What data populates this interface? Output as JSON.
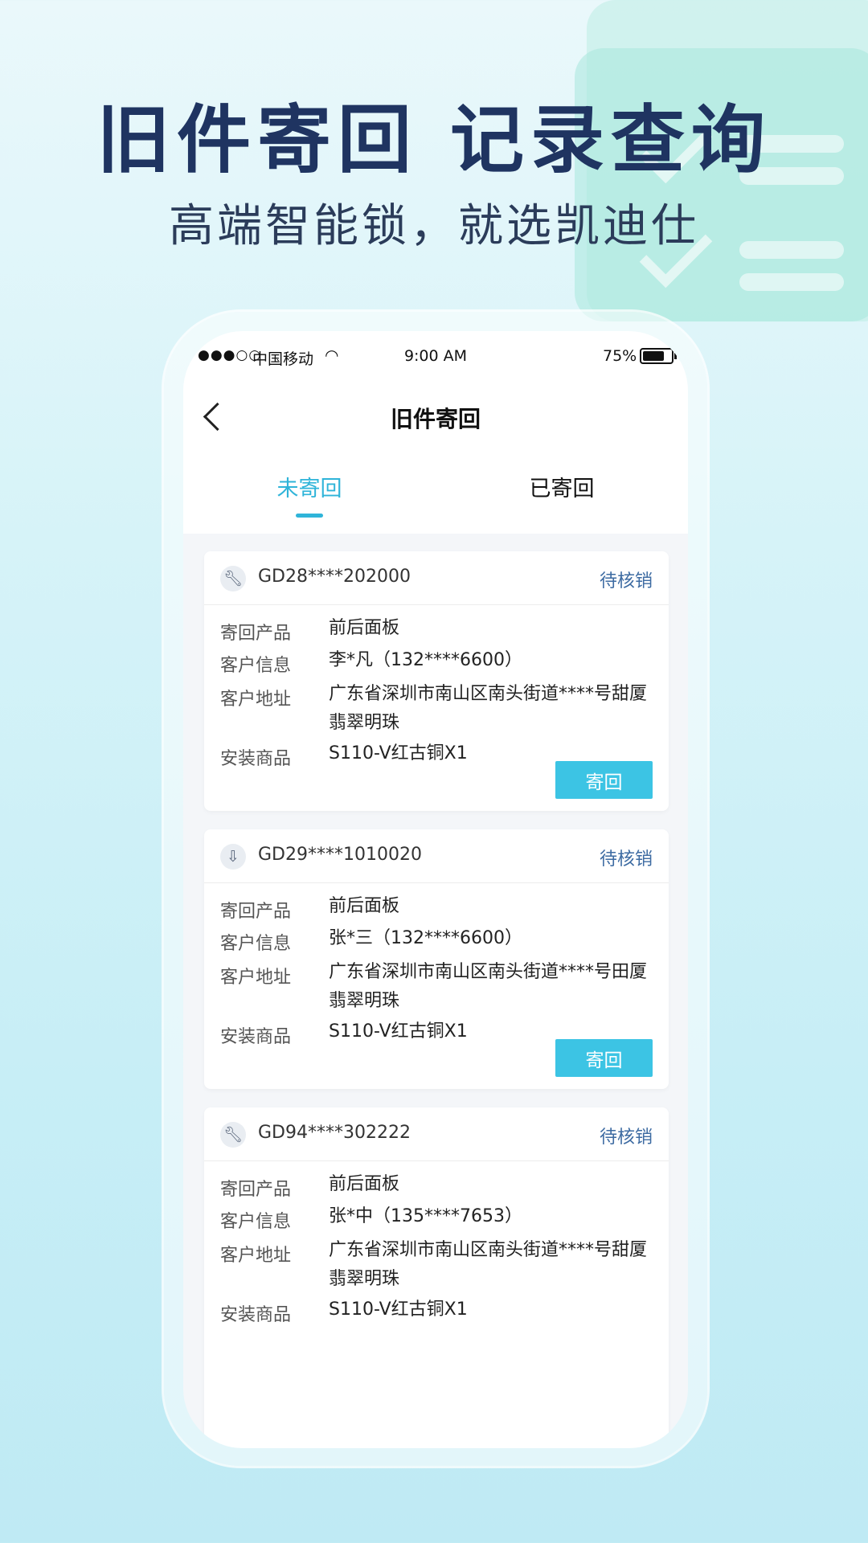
{
  "headline": "旧件寄回  记录查询",
  "subline": "高端智能锁，就选凯迪仕",
  "statusbar": {
    "signal": "●●●○○",
    "carrier": "中国移动",
    "wifi": "wifi-icon",
    "time": "9:00 AM",
    "battery": "75%"
  },
  "navbar": {
    "back": "back-arrow-icon",
    "title": "旧件寄回"
  },
  "tabs": [
    {
      "label": "未寄回",
      "active": true
    },
    {
      "label": "已寄回",
      "active": false
    }
  ],
  "labels": {
    "product": "寄回产品",
    "customer": "客户信息",
    "address": "客户地址",
    "goods": "安装商品"
  },
  "cards": [
    {
      "icon": "wrench-icon",
      "order_no": "GD28****202000",
      "status": "待核销",
      "product": "前后面板",
      "customer": "李*凡（132****6600）",
      "address": "广东省深圳市南山区南头街道****号甜厦翡翠明珠",
      "goods": "S110-V红古铜X1",
      "button": "寄回"
    },
    {
      "icon": "download-box-icon",
      "order_no": "GD29****1010020",
      "status": "待核销",
      "product": "前后面板",
      "customer": "张*三（132****6600）",
      "address": "广东省深圳市南山区南头街道****号田厦翡翠明珠",
      "goods": "S110-V红古铜X1",
      "button": "寄回"
    },
    {
      "icon": "wrench-icon",
      "order_no": "GD94****302222",
      "status": "待核销",
      "product": "前后面板",
      "customer": "张*中（135****7653）",
      "address": "广东省深圳市南山区南头街道****号甜厦翡翠明珠",
      "goods": "S110-V红古铜X1"
    }
  ],
  "colors": {
    "accent": "#2fb4d9",
    "button": "#3cc4e4",
    "status": "#3d6ba2",
    "headline": "#1f3461"
  }
}
